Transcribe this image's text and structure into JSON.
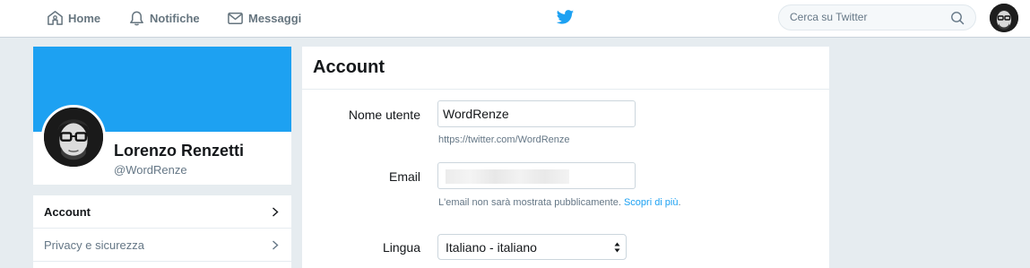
{
  "nav": {
    "home": "Home",
    "notifications": "Notifiche",
    "messages": "Messaggi",
    "search_placeholder": "Cerca su Twitter"
  },
  "profile": {
    "name": "Lorenzo Renzetti",
    "handle": "@WordRenze"
  },
  "menu": {
    "items": [
      {
        "label": "Account",
        "active": true
      },
      {
        "label": "Privacy e sicurezza",
        "active": false
      }
    ]
  },
  "account": {
    "title": "Account",
    "username_label": "Nome utente",
    "username_value": "WordRenze",
    "profile_url": "https://twitter.com/WordRenze",
    "email_label": "Email",
    "email_hint": "L'email non sarà mostrata pubblicamente.",
    "email_hint_link": "Scopri di più",
    "email_hint_end": ".",
    "language_label": "Lingua",
    "language_value": "Italiano - italiano"
  },
  "colors": {
    "brand": "#1da1f2",
    "page_background": "#e6ecf0",
    "muted_text": "#657786"
  }
}
